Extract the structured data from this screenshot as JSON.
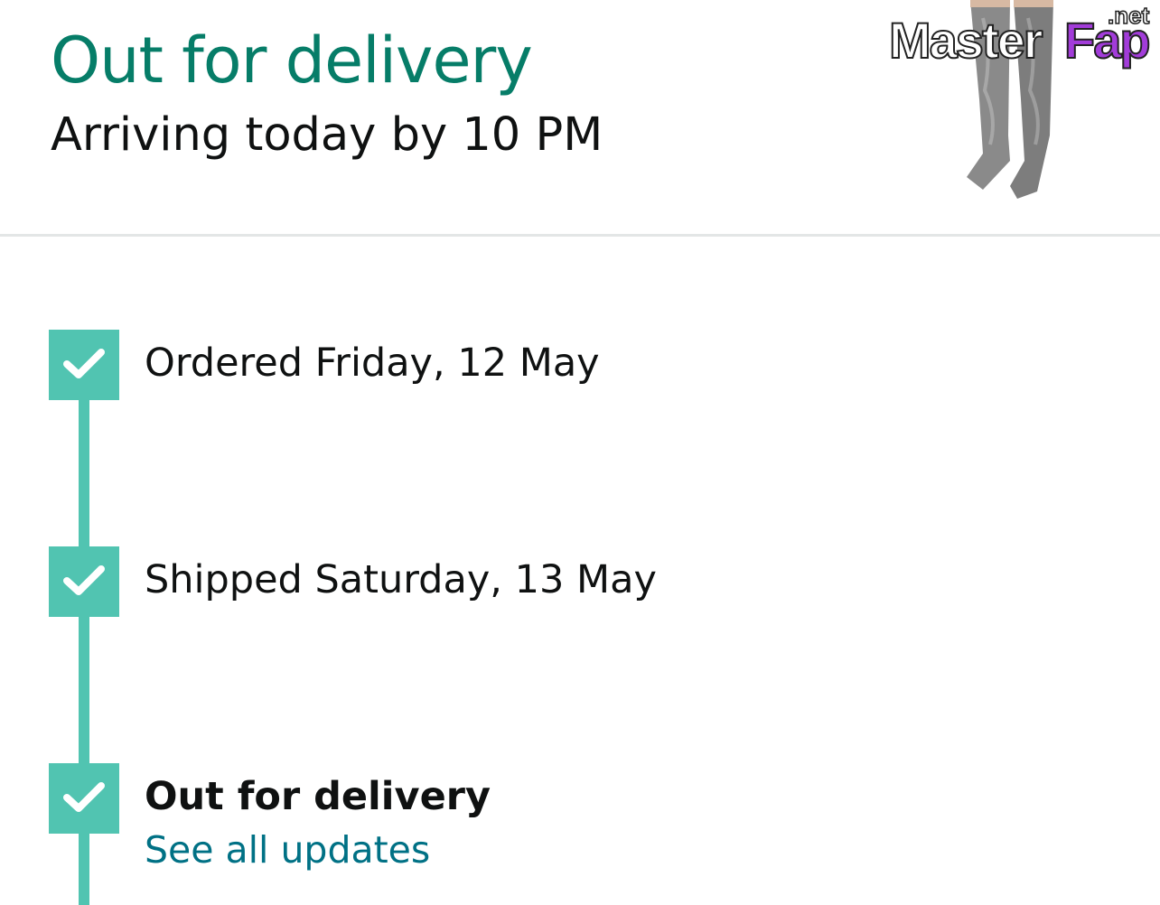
{
  "header": {
    "status_title": "Out for delivery",
    "arrival_text": "Arriving today by 10 PM",
    "product_image_icon": "knee-high-socks-image",
    "watermark": "MasterFap.net"
  },
  "timeline": {
    "accent_color": "#51c4b1",
    "steps": [
      {
        "label": "Ordered Friday, 12 May",
        "icon": "check-icon"
      },
      {
        "label": "Shipped Saturday, 13 May",
        "icon": "check-icon"
      },
      {
        "label": "Out for delivery",
        "icon": "check-icon"
      }
    ],
    "see_all_updates_label": "See all updates"
  }
}
